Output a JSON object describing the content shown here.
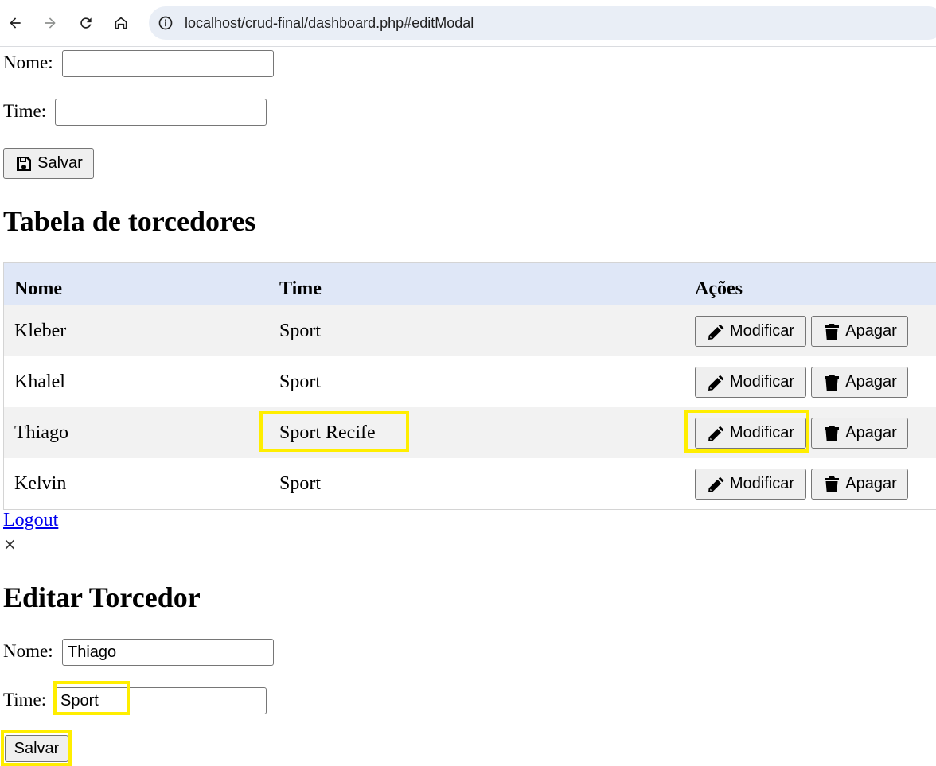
{
  "browser": {
    "url": "localhost/crud-final/dashboard.php#editModal"
  },
  "top_form": {
    "nome_label": "Nome:",
    "nome_value": "",
    "time_label": "Time:",
    "time_value": "",
    "save_label": "Salvar"
  },
  "table": {
    "title": "Tabela de torcedores",
    "headers": [
      "Nome",
      "Time",
      "Ações"
    ],
    "rows": [
      {
        "nome": "Kleber",
        "time": "Sport"
      },
      {
        "nome": "Khalel",
        "time": "Sport"
      },
      {
        "nome": "Thiago",
        "time": "Sport Recife"
      },
      {
        "nome": "Kelvin",
        "time": "Sport"
      }
    ],
    "modify_label": "Modificar",
    "delete_label": "Apagar"
  },
  "logout_label": "Logout",
  "close_glyph": "×",
  "edit_modal": {
    "title": "Editar Torcedor",
    "nome_label": "Nome:",
    "nome_value": "Thiago",
    "time_label": "Time:",
    "time_value": "Sport",
    "save_label": "Salvar"
  },
  "colors": {
    "highlight": "#ffee00",
    "table_header_bg": "#dfe7f7",
    "odd_row_bg": "#f2f2f2",
    "link": "#0000ee"
  },
  "icons": {
    "back": "arrow-left-icon",
    "forward": "arrow-right-icon",
    "reload": "reload-icon",
    "home": "home-icon",
    "info": "info-icon",
    "save": "floppy-disk-icon",
    "modify": "pencil-icon",
    "delete": "trash-icon"
  }
}
